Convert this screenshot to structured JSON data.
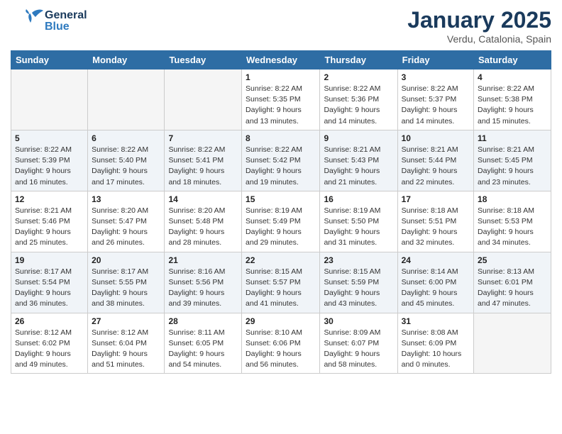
{
  "header": {
    "logo_general": "General",
    "logo_blue": "Blue",
    "month_title": "January 2025",
    "location": "Verdu, Catalonia, Spain"
  },
  "weekdays": [
    "Sunday",
    "Monday",
    "Tuesday",
    "Wednesday",
    "Thursday",
    "Friday",
    "Saturday"
  ],
  "weeks": [
    [
      {
        "day": "",
        "info": ""
      },
      {
        "day": "",
        "info": ""
      },
      {
        "day": "",
        "info": ""
      },
      {
        "day": "1",
        "info": "Sunrise: 8:22 AM\nSunset: 5:35 PM\nDaylight: 9 hours\nand 13 minutes."
      },
      {
        "day": "2",
        "info": "Sunrise: 8:22 AM\nSunset: 5:36 PM\nDaylight: 9 hours\nand 14 minutes."
      },
      {
        "day": "3",
        "info": "Sunrise: 8:22 AM\nSunset: 5:37 PM\nDaylight: 9 hours\nand 14 minutes."
      },
      {
        "day": "4",
        "info": "Sunrise: 8:22 AM\nSunset: 5:38 PM\nDaylight: 9 hours\nand 15 minutes."
      }
    ],
    [
      {
        "day": "5",
        "info": "Sunrise: 8:22 AM\nSunset: 5:39 PM\nDaylight: 9 hours\nand 16 minutes."
      },
      {
        "day": "6",
        "info": "Sunrise: 8:22 AM\nSunset: 5:40 PM\nDaylight: 9 hours\nand 17 minutes."
      },
      {
        "day": "7",
        "info": "Sunrise: 8:22 AM\nSunset: 5:41 PM\nDaylight: 9 hours\nand 18 minutes."
      },
      {
        "day": "8",
        "info": "Sunrise: 8:22 AM\nSunset: 5:42 PM\nDaylight: 9 hours\nand 19 minutes."
      },
      {
        "day": "9",
        "info": "Sunrise: 8:21 AM\nSunset: 5:43 PM\nDaylight: 9 hours\nand 21 minutes."
      },
      {
        "day": "10",
        "info": "Sunrise: 8:21 AM\nSunset: 5:44 PM\nDaylight: 9 hours\nand 22 minutes."
      },
      {
        "day": "11",
        "info": "Sunrise: 8:21 AM\nSunset: 5:45 PM\nDaylight: 9 hours\nand 23 minutes."
      }
    ],
    [
      {
        "day": "12",
        "info": "Sunrise: 8:21 AM\nSunset: 5:46 PM\nDaylight: 9 hours\nand 25 minutes."
      },
      {
        "day": "13",
        "info": "Sunrise: 8:20 AM\nSunset: 5:47 PM\nDaylight: 9 hours\nand 26 minutes."
      },
      {
        "day": "14",
        "info": "Sunrise: 8:20 AM\nSunset: 5:48 PM\nDaylight: 9 hours\nand 28 minutes."
      },
      {
        "day": "15",
        "info": "Sunrise: 8:19 AM\nSunset: 5:49 PM\nDaylight: 9 hours\nand 29 minutes."
      },
      {
        "day": "16",
        "info": "Sunrise: 8:19 AM\nSunset: 5:50 PM\nDaylight: 9 hours\nand 31 minutes."
      },
      {
        "day": "17",
        "info": "Sunrise: 8:18 AM\nSunset: 5:51 PM\nDaylight: 9 hours\nand 32 minutes."
      },
      {
        "day": "18",
        "info": "Sunrise: 8:18 AM\nSunset: 5:53 PM\nDaylight: 9 hours\nand 34 minutes."
      }
    ],
    [
      {
        "day": "19",
        "info": "Sunrise: 8:17 AM\nSunset: 5:54 PM\nDaylight: 9 hours\nand 36 minutes."
      },
      {
        "day": "20",
        "info": "Sunrise: 8:17 AM\nSunset: 5:55 PM\nDaylight: 9 hours\nand 38 minutes."
      },
      {
        "day": "21",
        "info": "Sunrise: 8:16 AM\nSunset: 5:56 PM\nDaylight: 9 hours\nand 39 minutes."
      },
      {
        "day": "22",
        "info": "Sunrise: 8:15 AM\nSunset: 5:57 PM\nDaylight: 9 hours\nand 41 minutes."
      },
      {
        "day": "23",
        "info": "Sunrise: 8:15 AM\nSunset: 5:59 PM\nDaylight: 9 hours\nand 43 minutes."
      },
      {
        "day": "24",
        "info": "Sunrise: 8:14 AM\nSunset: 6:00 PM\nDaylight: 9 hours\nand 45 minutes."
      },
      {
        "day": "25",
        "info": "Sunrise: 8:13 AM\nSunset: 6:01 PM\nDaylight: 9 hours\nand 47 minutes."
      }
    ],
    [
      {
        "day": "26",
        "info": "Sunrise: 8:12 AM\nSunset: 6:02 PM\nDaylight: 9 hours\nand 49 minutes."
      },
      {
        "day": "27",
        "info": "Sunrise: 8:12 AM\nSunset: 6:04 PM\nDaylight: 9 hours\nand 51 minutes."
      },
      {
        "day": "28",
        "info": "Sunrise: 8:11 AM\nSunset: 6:05 PM\nDaylight: 9 hours\nand 54 minutes."
      },
      {
        "day": "29",
        "info": "Sunrise: 8:10 AM\nSunset: 6:06 PM\nDaylight: 9 hours\nand 56 minutes."
      },
      {
        "day": "30",
        "info": "Sunrise: 8:09 AM\nSunset: 6:07 PM\nDaylight: 9 hours\nand 58 minutes."
      },
      {
        "day": "31",
        "info": "Sunrise: 8:08 AM\nSunset: 6:09 PM\nDaylight: 10 hours\nand 0 minutes."
      },
      {
        "day": "",
        "info": ""
      }
    ]
  ]
}
